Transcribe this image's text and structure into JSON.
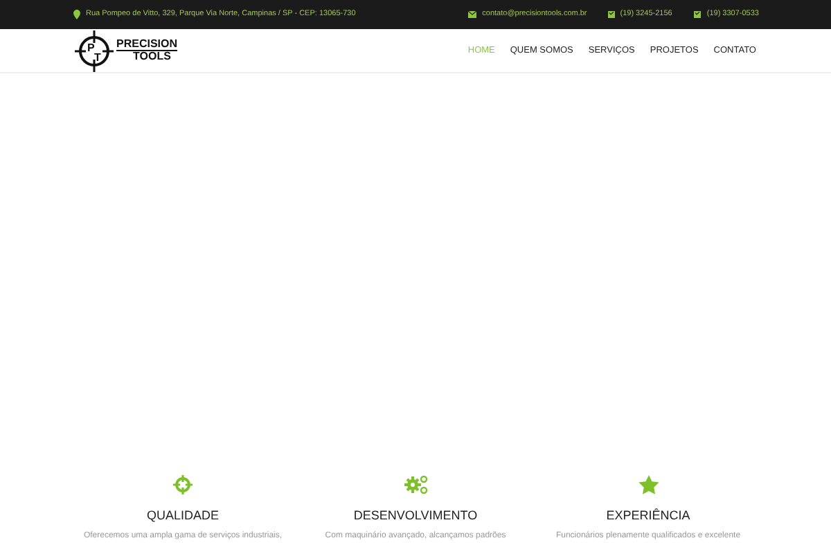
{
  "top_bar": {
    "address": "Rua Pompeo de Vitto, 329, Parque Via Norte, Campinas / SP - CEP: 13065-730",
    "email": "contato@precisiontools.com.br",
    "phones": [
      "(19) 3245-2156",
      "(19) 3307-0533"
    ]
  },
  "logo": {
    "line_1": "PRECISION",
    "line_2": "TOOLS",
    "monogram": [
      "P",
      "T"
    ]
  },
  "nav": [
    {
      "label": "HOME",
      "selected": true
    },
    {
      "label": "QUEM SOMOS",
      "selected": false
    },
    {
      "label": "SERVIÇOS",
      "selected": false
    },
    {
      "label": "PROJETOS",
      "selected": false
    },
    {
      "label": "CONTATO",
      "selected": false
    }
  ],
  "features": [
    {
      "kind": "crosshair",
      "title": "QUALIDADE",
      "text": "Oferecemos uma ampla gama de serviços industriais,"
    },
    {
      "kind": "gears",
      "title": "DESENVOLVIMENTO",
      "text": "Com maquinário avançado, alcançamos padrões"
    },
    {
      "kind": "star",
      "title": "EXPERIÊNCIA",
      "text": "Funcionários plenamente qualificados e excelente"
    }
  ]
}
